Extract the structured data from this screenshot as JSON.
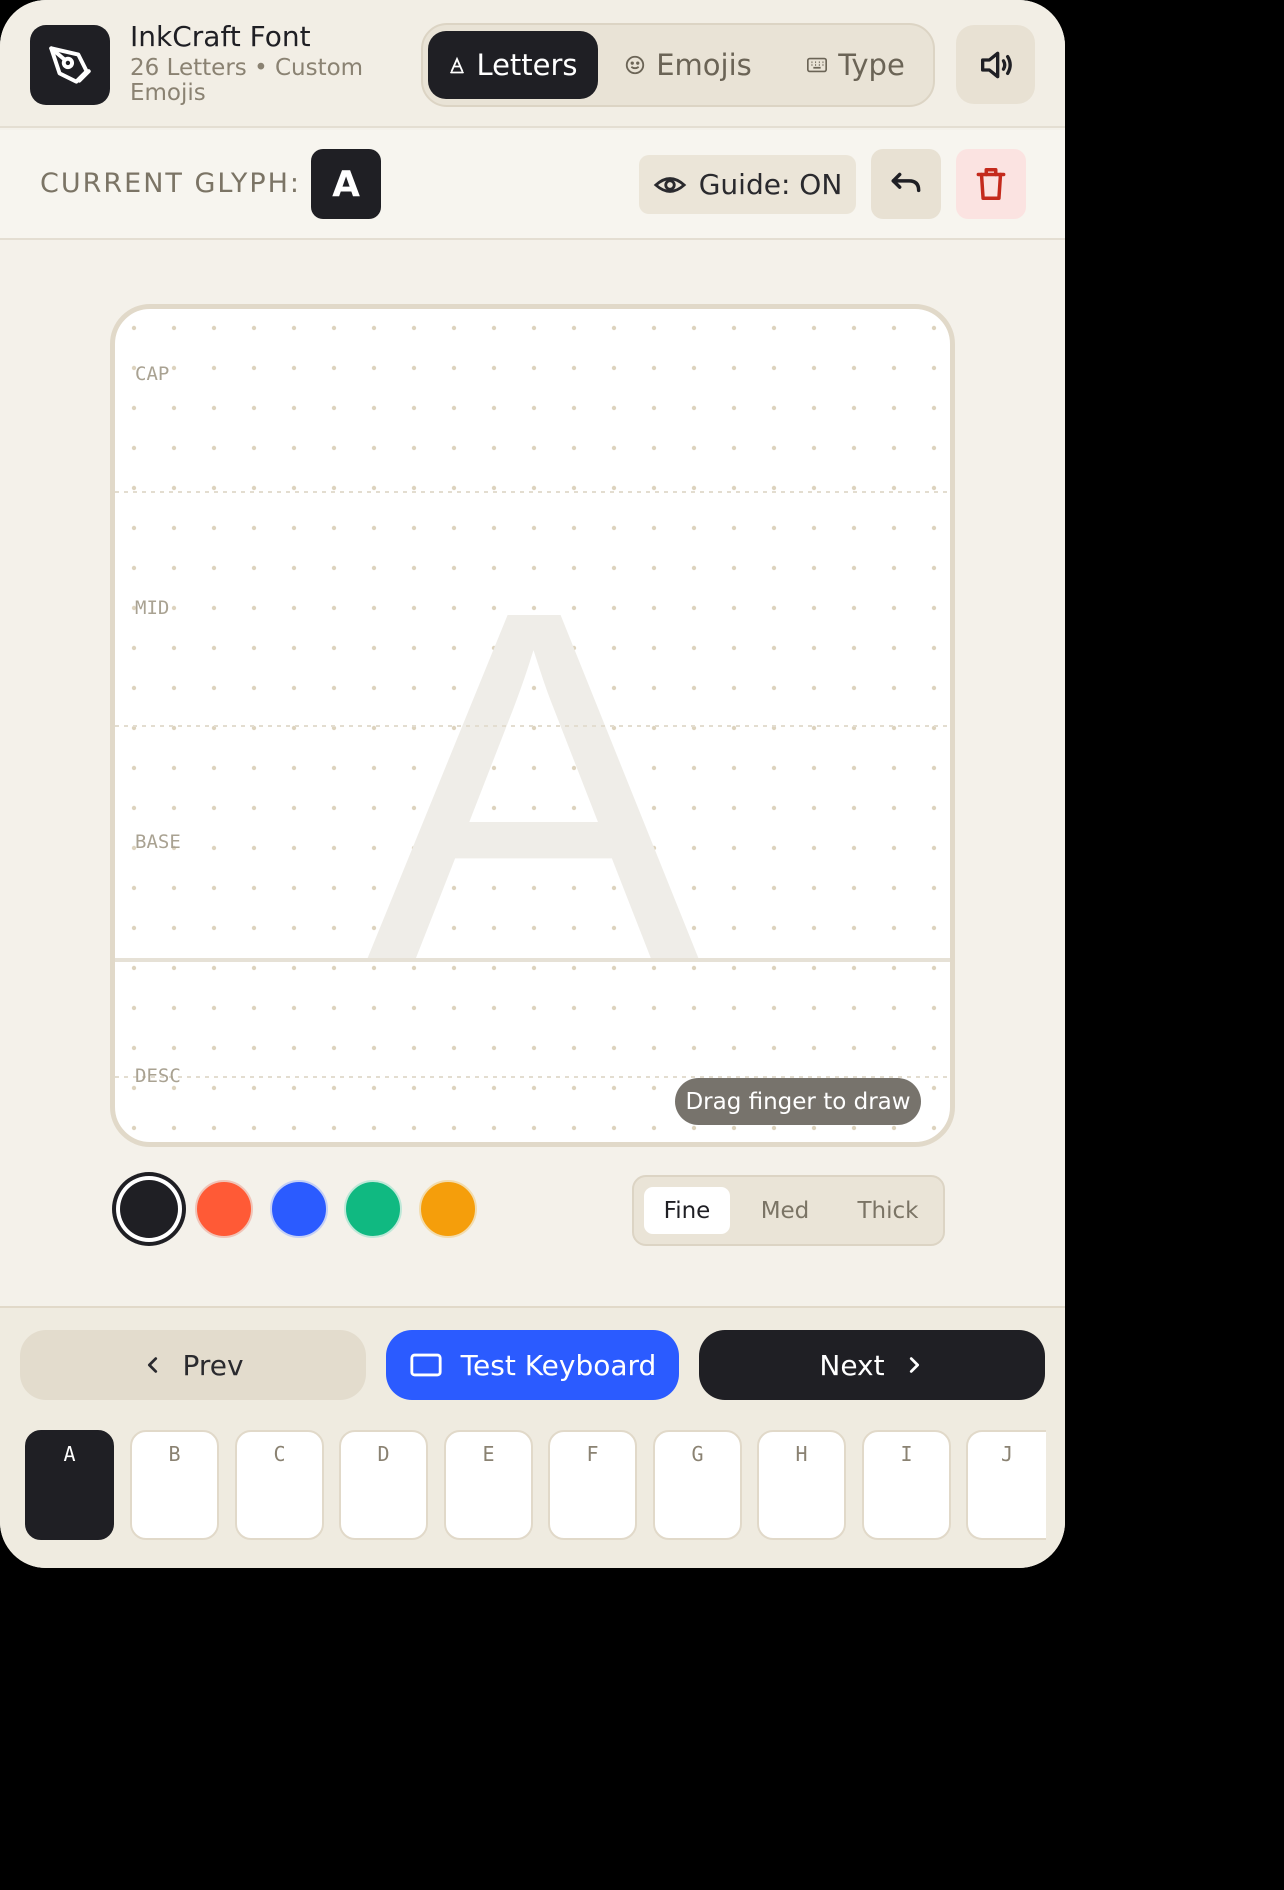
{
  "app": {
    "title": "InkCraft Font",
    "subtitle": "26 Letters • Custom Emojis",
    "logo_icon": "pen-nib-icon"
  },
  "mode_tabs": [
    {
      "label": "Letters",
      "icon": "letter-a-icon",
      "active": true
    },
    {
      "label": "Emojis",
      "icon": "smile-icon",
      "active": false
    },
    {
      "label": "Type",
      "icon": "keyboard-icon",
      "active": false
    }
  ],
  "speaker_icon": "speaker-icon",
  "glyph_bar": {
    "label": "CURRENT GLYPH:",
    "current_glyph": "A",
    "guide_label": "Guide: ON"
  },
  "canvas": {
    "guides": {
      "cap": "CAP",
      "mid": "MID",
      "base": "BASE",
      "desc": "DESC"
    },
    "guide_letter": "A",
    "hint": "Drag finger to draw"
  },
  "colors": [
    {
      "name": "black",
      "hex": "#1f1f24",
      "selected": true
    },
    {
      "name": "red",
      "hex": "#ff5a36",
      "selected": false
    },
    {
      "name": "blue",
      "hex": "#2b5bff",
      "selected": false
    },
    {
      "name": "green",
      "hex": "#10b981",
      "selected": false
    },
    {
      "name": "orange",
      "hex": "#f59e0b",
      "selected": false
    }
  ],
  "stroke_sizes": [
    {
      "label": "Fine",
      "active": true
    },
    {
      "label": "Med",
      "active": false
    },
    {
      "label": "Thick",
      "active": false
    }
  ],
  "nav": {
    "prev_label": "Prev",
    "test_label": "Test Keyboard",
    "next_label": "Next"
  },
  "letters": [
    "A",
    "B",
    "C",
    "D",
    "E",
    "F",
    "G",
    "H",
    "I",
    "J"
  ],
  "active_letter": "A",
  "accent": {
    "dark": "#1f1f24",
    "blue": "#2b5bff",
    "danger": "#c42a1c"
  }
}
